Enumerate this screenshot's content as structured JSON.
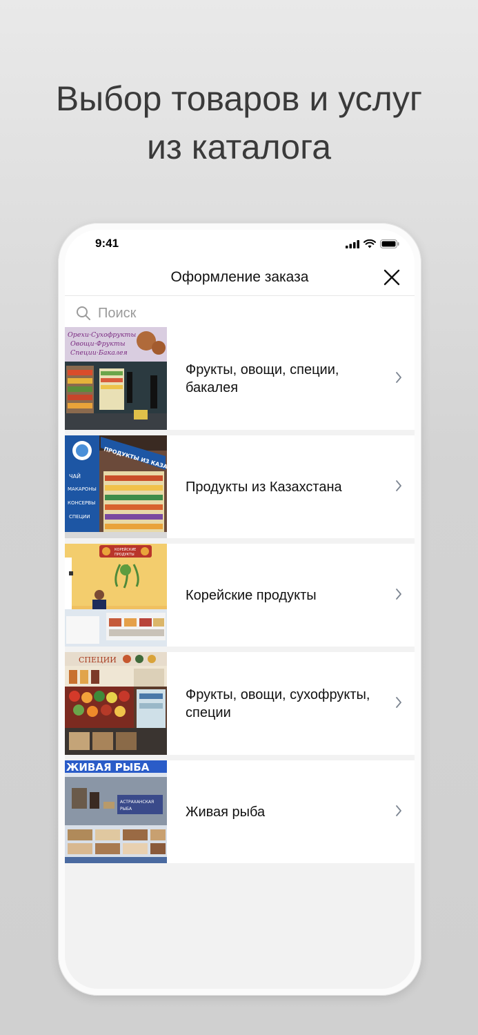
{
  "headline": {
    "line1": "Выбор товаров и услуг",
    "line2": "из каталога"
  },
  "status_bar": {
    "time": "9:41"
  },
  "nav": {
    "title": "Оформление заказа"
  },
  "search": {
    "placeholder": "Поиск"
  },
  "categories": [
    {
      "label": "Фрукты, овощи, специи, бакалея",
      "sign_text": "Орехи·Сухофрукты Овощи·Фрукты Специи·Бакалея"
    },
    {
      "label": "Продукты из Казахстана",
      "sign_text": "ПРОДУКТЫ ИЗ КАЗАХСТАНА"
    },
    {
      "label": "Корейские продукты",
      "sign_text": "КОРЕЙСКИЕ ПРОДУКТЫ"
    },
    {
      "label": "Фрукты, овощи, сухофрукты, специи",
      "sign_text": "СПЕЦИИ"
    },
    {
      "label": "Живая рыба",
      "sign_text": "ЖИВАЯ РЫБА"
    }
  ],
  "icons": {
    "search": "search-icon",
    "close": "close-icon",
    "chevron": "chevron-right-icon",
    "signal": "signal-icon",
    "wifi": "wifi-icon",
    "battery": "battery-icon"
  }
}
